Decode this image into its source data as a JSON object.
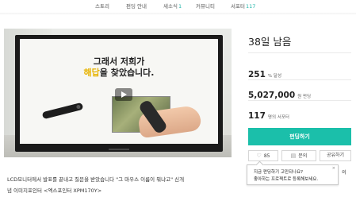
{
  "nav": {
    "items": [
      {
        "label": "스토리",
        "count": ""
      },
      {
        "label": "펀딩 안내",
        "count": ""
      },
      {
        "label": "새소식",
        "count": "1"
      },
      {
        "label": "커뮤니티",
        "count": ""
      },
      {
        "label": "서포터",
        "count": "117"
      }
    ]
  },
  "media": {
    "screen_line1": "그래서 저희가",
    "screen_line2_highlight": "해답",
    "screen_line2_rest": "을 찾았습니다."
  },
  "stats": {
    "days_left": "38일 남음",
    "percent": "251",
    "percent_unit": "% 달성",
    "amount": "5,027,000",
    "amount_unit": "원 펀딩",
    "supporters": "117",
    "supporters_unit": "명의 서포터"
  },
  "actions": {
    "fund_label": "펀딩하기",
    "like_count": "85",
    "inquiry_label": "문의",
    "share_label": "공유하기"
  },
  "tooltip": {
    "line1": "지금 펀딩하기 고민되나요?",
    "line2": "좋아하는 프로젝트로 등록해보세요.",
    "close": "×",
    "trailing": "의"
  },
  "caption": {
    "line1": "LCD모니터에서 발표를 끝내고 질문을 받았습니다 \"그 마우스 이름이 뭐냐고\" 신개",
    "line2": "념 이미지포인터 <엑스포인터 XPM170Y>"
  },
  "colors": {
    "accent": "#1bbfaa",
    "nav_count": "#1fb5a8",
    "screen_highlight": "#e7b300"
  },
  "icons": {
    "like": "heart-icon",
    "inquiry": "chat-icon",
    "play": "play-icon",
    "close": "close-icon"
  }
}
